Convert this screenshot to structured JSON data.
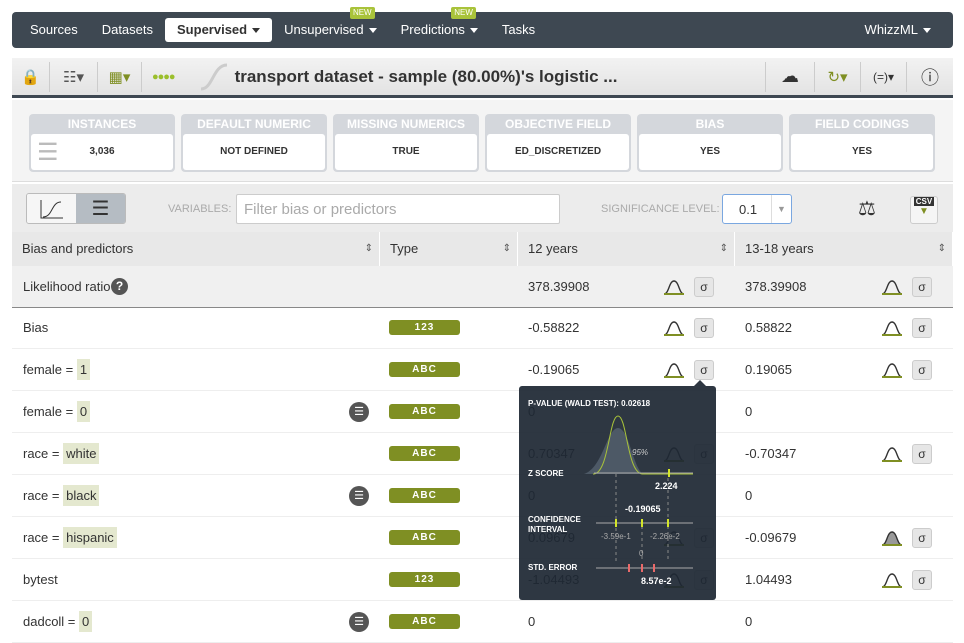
{
  "nav": {
    "items": [
      {
        "label": "Sources"
      },
      {
        "label": "Datasets"
      },
      {
        "label": "Supervised",
        "active": true,
        "caret": true
      },
      {
        "label": "Unsupervised",
        "caret": true,
        "badge": "NEW"
      },
      {
        "label": "Predictions",
        "caret": true,
        "badge": "NEW"
      },
      {
        "label": "Tasks"
      }
    ],
    "right": "WhizzML"
  },
  "toolbar": {
    "title": "transport dataset - sample (80.00%)'s logistic ..."
  },
  "stats": [
    {
      "label": "INSTANCES",
      "value": "3,036"
    },
    {
      "label": "DEFAULT NUMERIC",
      "value": "NOT DEFINED"
    },
    {
      "label": "MISSING NUMERICS",
      "value": "TRUE"
    },
    {
      "label": "OBJECTIVE FIELD",
      "value": "ED_DISCRETIZED"
    },
    {
      "label": "BIAS",
      "value": "YES"
    },
    {
      "label": "FIELD CODINGS",
      "value": "YES"
    }
  ],
  "controls": {
    "variables_label": "VARIABLES:",
    "filter_placeholder": "Filter bias or predictors",
    "significance_label": "SIGNIFICANCE LEVEL:",
    "significance_value": "0.1",
    "csv": "CSV"
  },
  "table": {
    "headers": [
      "Bias and predictors",
      "Type",
      "12 years",
      "13-18 years"
    ],
    "likelihood": {
      "label": "Likelihood ratio",
      "v1": "378.39908",
      "v2": "378.39908"
    },
    "rows": [
      {
        "name": "Bias",
        "value": "",
        "type": "123",
        "v1": "-0.58822",
        "v2": "0.58822",
        "stats1": true,
        "stats2": true
      },
      {
        "name": "female = ",
        "value": "1",
        "type": "ABC",
        "v1": "-0.19065",
        "v2": "0.19065",
        "stats1": true,
        "stats2": true
      },
      {
        "name": "female = ",
        "value": "0",
        "type": "ABC",
        "v1": "0",
        "v2": "0",
        "filter": true
      },
      {
        "name": "race = ",
        "value": "white",
        "type": "ABC",
        "v1": "0.70347",
        "v2": "-0.70347",
        "stats1": true,
        "stats2": true
      },
      {
        "name": "race = ",
        "value": "black",
        "type": "ABC",
        "v1": "0",
        "v2": "0",
        "filter": true
      },
      {
        "name": "race = ",
        "value": "hispanic",
        "type": "ABC",
        "v1": "0.09679",
        "v2": "-0.09679",
        "stats1": true,
        "stats2": true,
        "faded2": true
      },
      {
        "name": "bytest",
        "value": "",
        "type": "123",
        "v1": "-1.04493",
        "v2": "1.04493",
        "stats1": true,
        "stats2": true
      },
      {
        "name": "dadcoll = ",
        "value": "0",
        "type": "ABC",
        "v1": "0",
        "v2": "0",
        "filter": true
      }
    ]
  },
  "tooltip": {
    "pvalue": "P-VALUE (WALD TEST): 0.02618",
    "pct": "95%",
    "zscore_label": "Z SCORE",
    "zscore": "2.224",
    "ci_label1": "CONFIDENCE",
    "ci_label2": "INTERVAL",
    "coef": "-0.19065",
    "ci_low": "-3.59e-1",
    "ci_high": "-2.26e-2",
    "zero": "0",
    "se_label": "STD. ERROR",
    "se": "8.57e-2"
  },
  "colors": {
    "nav": "#3e4852",
    "accent": "#a9c33a",
    "badge": "#7f8f23"
  }
}
